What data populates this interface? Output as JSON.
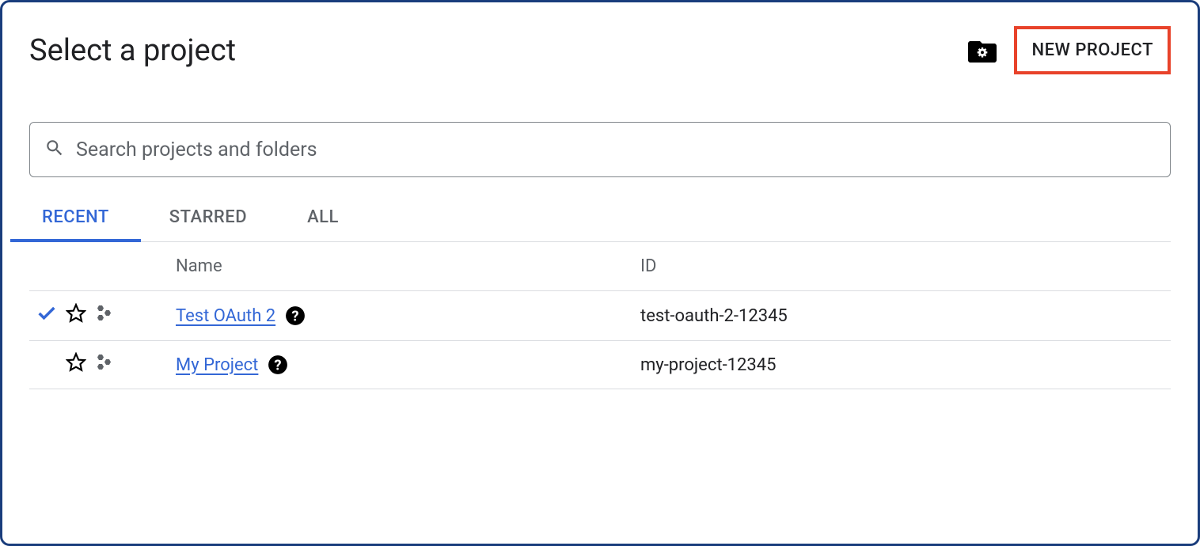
{
  "header": {
    "title": "Select a project",
    "new_project_label": "NEW PROJECT"
  },
  "search": {
    "placeholder": "Search projects and folders"
  },
  "tabs": [
    {
      "label": "RECENT",
      "active": true
    },
    {
      "label": "STARRED",
      "active": false
    },
    {
      "label": "ALL",
      "active": false
    }
  ],
  "table": {
    "columns": {
      "name": "Name",
      "id": "ID"
    },
    "rows": [
      {
        "selected": true,
        "name": "Test OAuth 2",
        "id": "test-oauth-2-12345"
      },
      {
        "selected": false,
        "name": "My Project",
        "id": "my-project-12345"
      }
    ]
  }
}
